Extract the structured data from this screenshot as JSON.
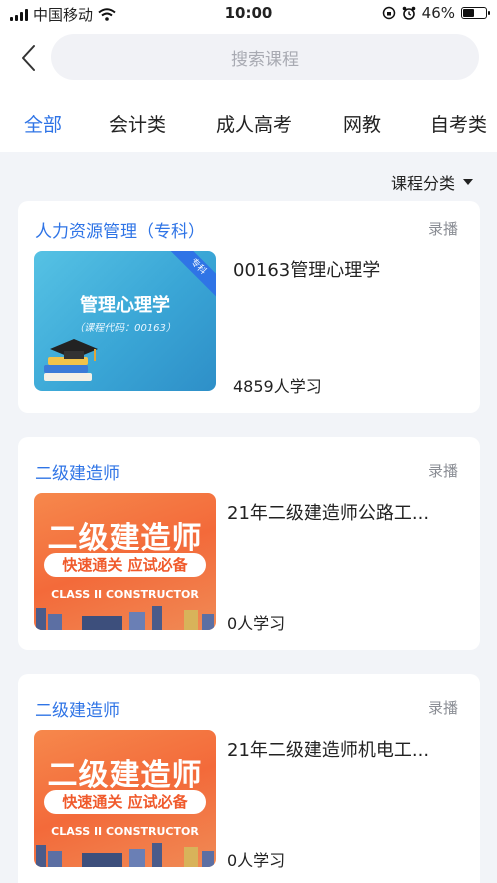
{
  "status": {
    "carrier": "中国移动",
    "time": "10:00",
    "battery": "46%"
  },
  "search": {
    "placeholder": "搜索课程"
  },
  "tabs": [
    {
      "label": "全部",
      "active": true
    },
    {
      "label": "会计类"
    },
    {
      "label": "成人高考"
    },
    {
      "label": "网教"
    },
    {
      "label": "自考类"
    }
  ],
  "sort": {
    "label": "课程分类"
  },
  "courses": [
    {
      "category": "人力资源管理（专科）",
      "tag": "录播",
      "title": "00163管理心理学",
      "learners": "4859人学习",
      "thumb": {
        "title": "管理心理学",
        "subtitle": "（课程代码：00163）",
        "ribbon": "专科"
      }
    },
    {
      "category": "二级建造师",
      "tag": "录播",
      "title": "21年二级建造师公路工...",
      "learners": "0人学习",
      "thumb": {
        "big": "二级建造师",
        "pill": "快速通关 应试必备",
        "eng": "CLASS II CONSTRUCTOR"
      }
    },
    {
      "category": "二级建造师",
      "tag": "录播",
      "title": "21年二级建造师机电工...",
      "learners": "0人学习",
      "thumb": {
        "big": "二级建造师",
        "pill": "快速通关 应试必备",
        "eng": "CLASS II CONSTRUCTOR"
      }
    }
  ],
  "colors": {
    "accent": "#2f74e6",
    "background": "#f2f4f8"
  }
}
